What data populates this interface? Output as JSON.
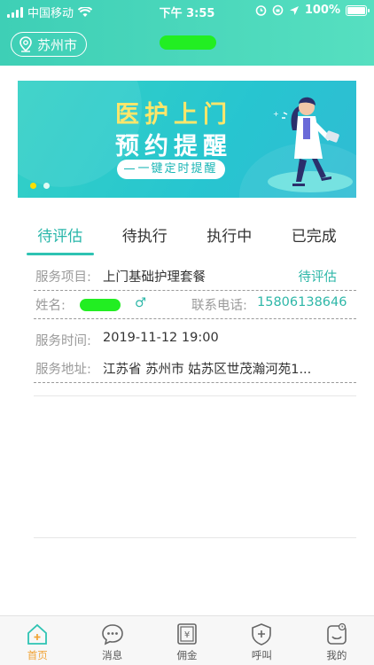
{
  "status_bar": {
    "carrier": "中国移动",
    "time": "下午 3:55",
    "battery": "100%"
  },
  "header": {
    "city": "苏州市"
  },
  "banner": {
    "line1": "医护上门",
    "line2": "预约提醒",
    "button": "一键定时提醒",
    "colors": {
      "title_accent": "#ffe66a",
      "button_text": "#18b5b5"
    }
  },
  "tabs": [
    {
      "label": "待评估"
    },
    {
      "label": "待执行"
    },
    {
      "label": "执行中"
    },
    {
      "label": "已完成"
    }
  ],
  "order": {
    "service_item_label": "服务项目:",
    "service_item_value": "上门基础护理套餐",
    "status": "待评估",
    "name_label": "姓名:",
    "gender_symbol": "♂",
    "phone_label": "联系电话:",
    "phone_value": "15806138646",
    "time_label": "服务时间:",
    "time_value": "2019-11-12 19:00",
    "address_label": "服务地址:",
    "address_value": "江苏省 苏州市 姑苏区世茂瀚河苑1..."
  },
  "bottom_nav": [
    {
      "label": "首页",
      "icon": "home-icon"
    },
    {
      "label": "消息",
      "icon": "message-icon"
    },
    {
      "label": "佣金",
      "icon": "commission-icon"
    },
    {
      "label": "呼叫",
      "icon": "call-shield-icon"
    },
    {
      "label": "我的",
      "icon": "profile-icon"
    }
  ],
  "colors": {
    "accent": "#2ec3b3",
    "nav_active": "#f1a53a",
    "header": "#3ecfb6"
  }
}
